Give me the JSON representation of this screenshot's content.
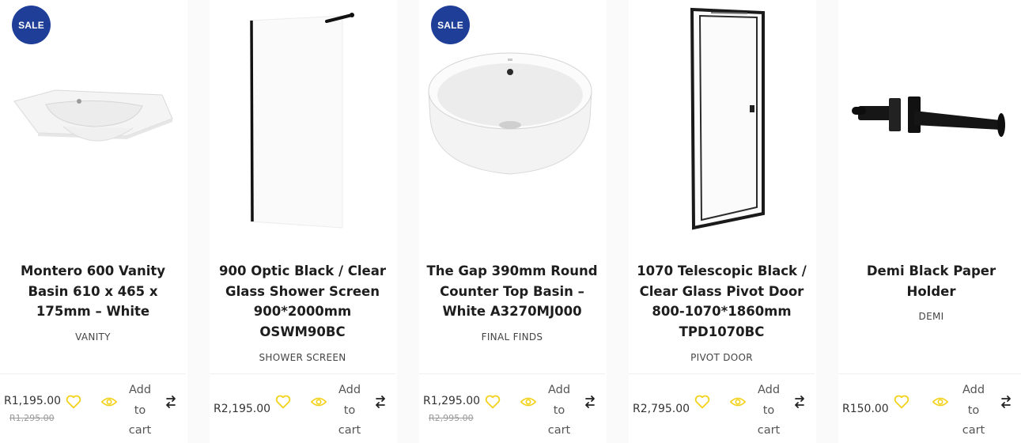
{
  "products": [
    {
      "sale_badge": "SALE",
      "title_lines": [
        "Montero 600 Vanity",
        "Basin 610 x 465 x",
        "175mm – White"
      ],
      "category": "VANITY",
      "price": "R1,195.00",
      "old_price": "R1,295.00",
      "add_to_cart": [
        "Add",
        "to",
        "cart"
      ]
    },
    {
      "sale_badge": "",
      "title_lines": [
        "900 Optic Black / Clear",
        "Glass Shower Screen",
        "900*2000mm",
        "OSWM90BC"
      ],
      "category": "SHOWER SCREEN",
      "price": "R2,195.00",
      "old_price": "",
      "add_to_cart": [
        "Add",
        "to",
        "cart"
      ]
    },
    {
      "sale_badge": "SALE",
      "title_lines": [
        "The Gap 390mm Round",
        "Counter Top Basin –",
        "White A3270MJ000"
      ],
      "category": "FINAL FINDS",
      "price": "R1,295.00",
      "old_price": "R2,995.00",
      "add_to_cart": [
        "Add",
        "to",
        "cart"
      ]
    },
    {
      "sale_badge": "",
      "title_lines": [
        "1070 Telescopic Black /",
        "Clear Glass Pivot Door",
        "800-1070*1860mm",
        "TPD1070BC"
      ],
      "category": "PIVOT DOOR",
      "price": "R2,795.00",
      "old_price": "",
      "add_to_cart": [
        "Add",
        "to",
        "cart"
      ]
    },
    {
      "sale_badge": "",
      "title_lines": [
        "Demi Black Paper",
        "Holder"
      ],
      "category": "DEMI",
      "price": "R150.00",
      "old_price": "",
      "add_to_cart": [
        "Add",
        "to",
        "cart"
      ]
    }
  ],
  "icons": {
    "wishlist": "heart-icon",
    "quickview": "eye-icon",
    "compare": "compare-arrows-icon"
  },
  "colors": {
    "sale_badge": "#1f3e97",
    "icon_accent": "#f2d21b"
  }
}
